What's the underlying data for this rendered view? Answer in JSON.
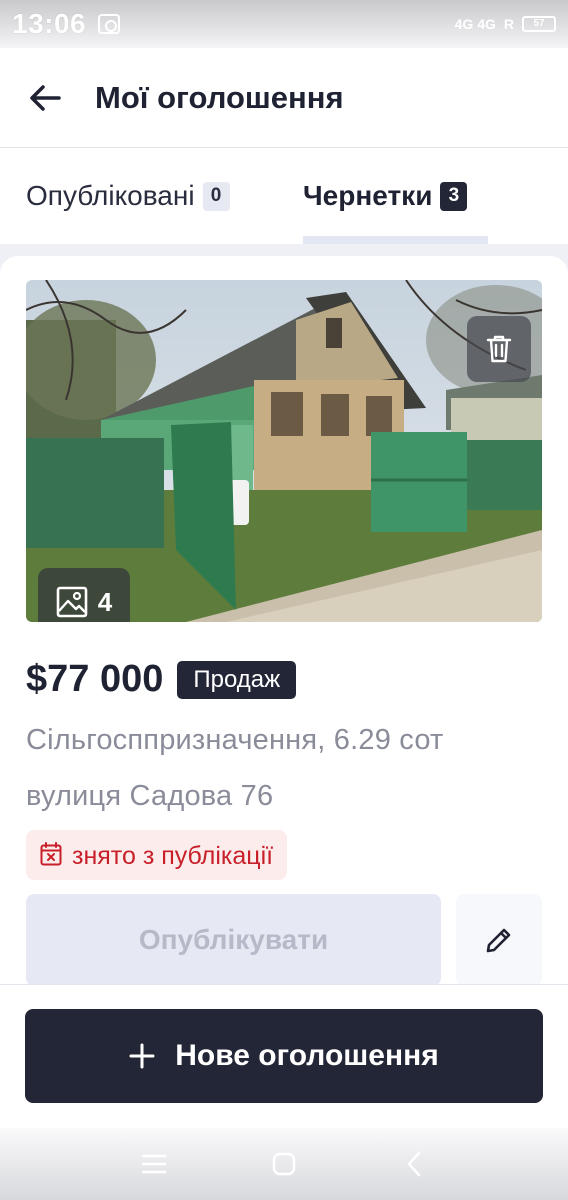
{
  "status_bar": {
    "time": "13:06",
    "network": "4G 4G",
    "roaming": "R",
    "battery": "57"
  },
  "header": {
    "title": "Мої оголошення",
    "back_icon": "arrow-left-icon"
  },
  "tabs": [
    {
      "label": "Опубліковані",
      "count": "0",
      "active": false
    },
    {
      "label": "Чернетки",
      "count": "3",
      "active": true
    }
  ],
  "listing": {
    "photo_count": "4",
    "price": "$77 000",
    "deal_type": "Продаж",
    "description": "Сільгосппризначення, 6.29 сот",
    "address": "вулиця Садова 76",
    "status": "знято з публікації",
    "publish_label": "Опублікувати",
    "icons": {
      "delete": "trash-icon",
      "photos": "image-icon",
      "status": "calendar-x-icon",
      "edit": "pencil-icon"
    }
  },
  "new_ad": {
    "label": "Нове оголошення",
    "icon": "plus-icon"
  },
  "colors": {
    "primary_dark": "#232637",
    "status_red": "#c8202a",
    "status_bg": "#fdecec",
    "disabled_bg": "#e6e9f4",
    "muted_text": "#8a8d99"
  }
}
